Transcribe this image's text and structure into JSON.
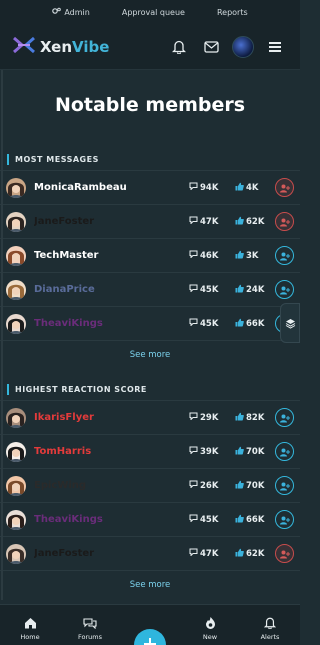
{
  "admin_bar": {
    "admin": "Admin",
    "approval": "Approval queue",
    "reports": "Reports"
  },
  "header": {
    "logo_a": "Xen",
    "logo_b": "Vibe"
  },
  "page_title": "Notable members",
  "most_messages": {
    "title": "MOST MESSAGES",
    "see_more": "See more",
    "rows": [
      {
        "name": "MonicaRambeau",
        "name_color": "#ffffff",
        "messages": "94K",
        "likes": "4K",
        "follow": "red"
      },
      {
        "name": "JaneFoster",
        "name_color": "#1a1a1a",
        "messages": "47K",
        "likes": "62K",
        "follow": "red"
      },
      {
        "name": "TechMaster",
        "name_color": "#ffffff",
        "messages": "46K",
        "likes": "3K",
        "follow": "blue"
      },
      {
        "name": "DianaPrice",
        "name_color": "#5a6c9a",
        "messages": "45K",
        "likes": "24K",
        "follow": "blue"
      },
      {
        "name": "TheaviKings",
        "name_color": "#6a2d7a",
        "messages": "45K",
        "likes": "66K",
        "follow": "blue"
      }
    ]
  },
  "highest_reaction": {
    "title": "HIGHEST REACTION SCORE",
    "see_more": "See more",
    "rows": [
      {
        "name": "IkarisFlyer",
        "name_color": "#e33b3b",
        "messages": "29K",
        "likes": "82K",
        "follow": "blue"
      },
      {
        "name": "TomHarris",
        "name_color": "#e33b3b",
        "messages": "39K",
        "likes": "70K",
        "follow": "blue"
      },
      {
        "name": "EpicWing",
        "name_color": "#2a2a2a",
        "messages": "26K",
        "likes": "70K",
        "follow": "blue"
      },
      {
        "name": "TheaviKings",
        "name_color": "#6a2d7a",
        "messages": "45K",
        "likes": "66K",
        "follow": "blue"
      },
      {
        "name": "JaneFoster",
        "name_color": "#1a1a1a",
        "messages": "47K",
        "likes": "62K",
        "follow": "red"
      }
    ]
  },
  "bottom_nav": {
    "home": "Home",
    "forums": "Forums",
    "new": "New",
    "alerts": "Alerts"
  },
  "colors": {
    "accent": "#2fb6de",
    "bg": "#1e2d33",
    "bar": "#182429"
  }
}
